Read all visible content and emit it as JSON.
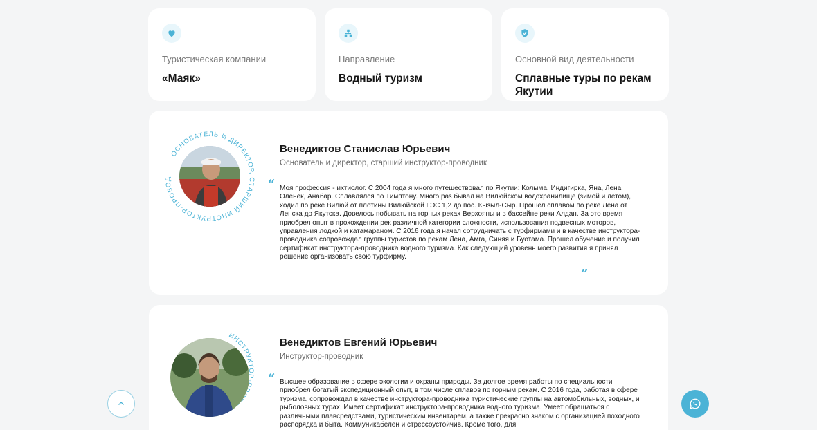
{
  "info_cards": [
    {
      "label": "Туристическая компании",
      "value": "«Маяк»",
      "icon": "heart-icon"
    },
    {
      "label": "Направление",
      "value": "Водный туризм",
      "icon": "hierarchy-icon"
    },
    {
      "label": "Основной вид деятельности",
      "value": "Сплавные туры по рекам Якутии",
      "icon": "shield-check-icon"
    }
  ],
  "persons": [
    {
      "name": "Венедиктов Станислав Юрьевич",
      "role": "Основатель и директор, старший инструктор-проводник",
      "ring_text": "ОСНОВАТЕЛЬ И ДИРЕКТОР, СТАРШИЙ ИНСТРУКТОР-ПРОВОДНИК",
      "bio": "Моя профессия - ихтиолог. С 2004 года я много путешествовал по Якутии: Колыма, Индигирка, Яна, Лена, Оленек, Анабар. Сплавлялся по Тимптону. Много раз бывал на Вилюйском водохранилище (зимой и летом), ходил по реке Вилюй от плотины Вилюйской ГЭС 1,2 до пос. Кызыл-Сыр. Прошел сплавом по реке Лена от Ленска до Якутска. Довелось побывать на горных реках Верхояны и в бассейне реки Алдан. За это время приобрел опыт в прохождении рек различной категории сложности, использования подвесных моторов, управления лодкой и катамараном. С 2016 года я начал сотрудничать с турфирмами и в качестве инструктора-проводника сопровождал группы туристов по рекам Лена, Амга, Синяя и Буотама. Прошел обучение и получил сертификат инструктора-проводника водного туризма. Как следующий уровень моего развития я принял решение организовать свою турфирму."
    },
    {
      "name": "Венедиктов Евгений Юрьевич",
      "role": "Инструктор-проводник",
      "ring_text": "ИНСТРУКТОР-ПРОВОДНИК",
      "bio": "Высшее образование в сфере экологии и охраны природы. За долгое время работы по специальности приобрел богатый экспедиционный опыт, в том числе сплавов по горным рекам. С 2016 года, работая в сфере туризма, сопровождал в качестве инструктора-проводника туристические группы на автомобильных, водных, и рыболовных турах. Имеет сертификат инструктора-проводника водного туризма. Умеет обращаться с различными плавсредствами, туристическим инвентарем, а также прекрасно знаком с организацией походного распорядка и быта. Коммуникабелен и стрессоустойчив. Кроме того, для"
    }
  ],
  "quote_open": "“",
  "quote_close": "”",
  "accent_color": "#4bb3d6",
  "scroll_top_icon": "chevron-up-icon",
  "whatsapp_icon": "whatsapp-icon"
}
